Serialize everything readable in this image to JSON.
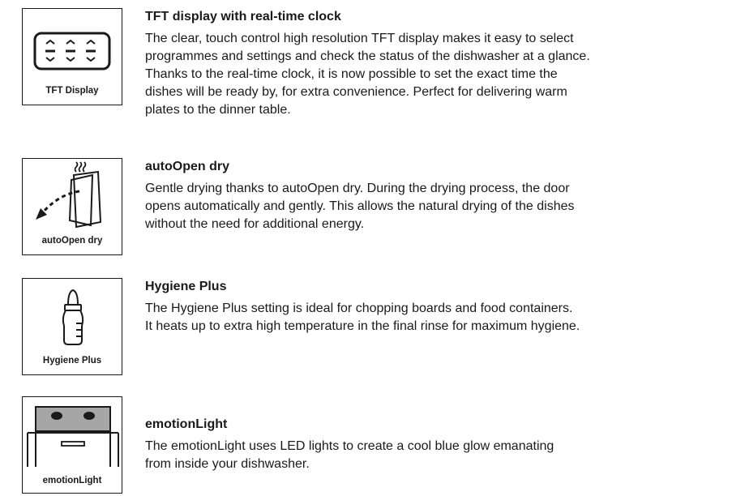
{
  "features": [
    {
      "icon_label": "TFT Display",
      "icon": "tft-display-icon",
      "title": "TFT display with real-time clock",
      "lines": [
        "The clear, touch control high resolution TFT display makes it easy to select",
        "programmes and settings and check the status of the dishwasher at a glance.",
        "Thanks to the real-time clock, it is now possible to set the exact time the",
        "dishes will be ready by, for extra convenience. Perfect for delivering warm",
        "plates to the dinner table."
      ]
    },
    {
      "icon_label": "autoOpen dry",
      "icon": "auto-open-dry-icon",
      "title": "autoOpen dry",
      "lines": [
        "Gentle drying thanks to autoOpen dry. During the drying process, the door",
        "opens automatically and gently. This allows the natural drying of the dishes",
        "without the need for additional energy."
      ]
    },
    {
      "icon_label": "Hygiene Plus",
      "icon": "baby-bottle-icon",
      "title": "Hygiene Plus",
      "lines": [
        "The Hygiene Plus setting is ideal for chopping boards and food containers.",
        "It heats up to extra high temperature in the final rinse for maximum hygiene."
      ]
    },
    {
      "icon_label": "emotionLight",
      "icon": "dishwasher-light-icon",
      "title": "emotionLight",
      "lines": [
        "The emotionLight uses LED lights to create a cool blue glow emanating",
        "from inside your dishwasher."
      ]
    }
  ]
}
